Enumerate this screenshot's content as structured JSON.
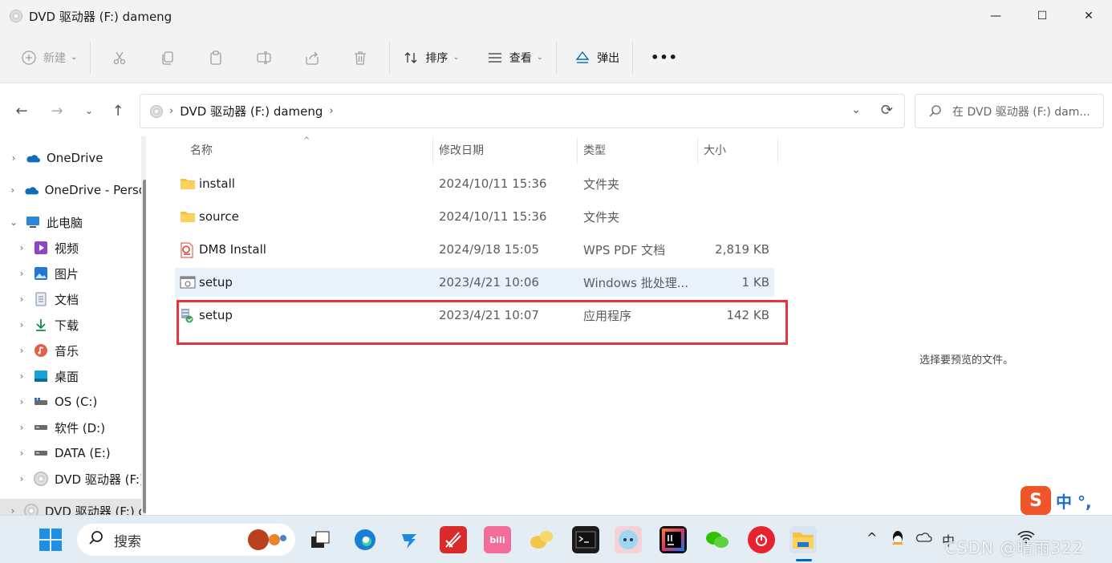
{
  "window": {
    "title": "DVD 驱动器 (F:) dameng",
    "minimize": "—",
    "maximize": "☐",
    "close": "✕"
  },
  "toolbar": {
    "new_label": "新建",
    "sort_label": "排序",
    "view_label": "查看",
    "eject_label": "弹出",
    "more_label": "•••"
  },
  "address": {
    "path": "DVD 驱动器 (F:) dameng",
    "search_placeholder": "在 DVD 驱动器 (F:) dam..."
  },
  "sidebar": {
    "items": [
      {
        "label": "OneDrive",
        "icon": "onedrive-icon"
      },
      {
        "label": "OneDrive - Perso",
        "icon": "onedrive-icon"
      },
      {
        "label": "此电脑",
        "icon": "pc-icon"
      },
      {
        "label": "视频",
        "icon": "video-icon"
      },
      {
        "label": "图片",
        "icon": "picture-icon"
      },
      {
        "label": "文档",
        "icon": "document-icon"
      },
      {
        "label": "下载",
        "icon": "download-icon"
      },
      {
        "label": "音乐",
        "icon": "music-icon"
      },
      {
        "label": "桌面",
        "icon": "desktop-icon"
      },
      {
        "label": "OS (C:)",
        "icon": "drive-icon"
      },
      {
        "label": "软件 (D:)",
        "icon": "drive-icon"
      },
      {
        "label": "DATA (E:)",
        "icon": "drive-icon"
      },
      {
        "label": "DVD 驱动器 (F:)",
        "icon": "dvd-icon"
      },
      {
        "label": "DVD 驱动器 (F:) d",
        "icon": "dvd-icon"
      }
    ]
  },
  "columns": {
    "name": "名称",
    "date": "修改日期",
    "type": "类型",
    "size": "大小"
  },
  "files": [
    {
      "name": "install",
      "date": "2024/10/11 15:36",
      "type": "文件夹",
      "size": "",
      "icon": "folder-icon"
    },
    {
      "name": "source",
      "date": "2024/10/11 15:36",
      "type": "文件夹",
      "size": "",
      "icon": "folder-icon"
    },
    {
      "name": "DM8 Install",
      "date": "2024/9/18 15:05",
      "type": "WPS PDF 文档",
      "size": "2,819 KB",
      "icon": "pdf-icon"
    },
    {
      "name": "setup",
      "date": "2023/4/21 10:06",
      "type": "Windows 批处理...",
      "size": "1 KB",
      "icon": "batch-icon"
    },
    {
      "name": "setup",
      "date": "2023/4/21 10:07",
      "type": "应用程序",
      "size": "142 KB",
      "icon": "installer-icon"
    }
  ],
  "preview": {
    "message": "选择要预览的文件。"
  },
  "ime": {
    "logo": "S",
    "mode": "中 °,"
  },
  "taskbar": {
    "search_label": "搜索",
    "tray_ime": "中",
    "watermark": "CSDN @晴雨322"
  },
  "colors": {
    "highlight_box": "#e8323c",
    "hover_row": "#e9f1fb",
    "accent": "#0067c0"
  }
}
